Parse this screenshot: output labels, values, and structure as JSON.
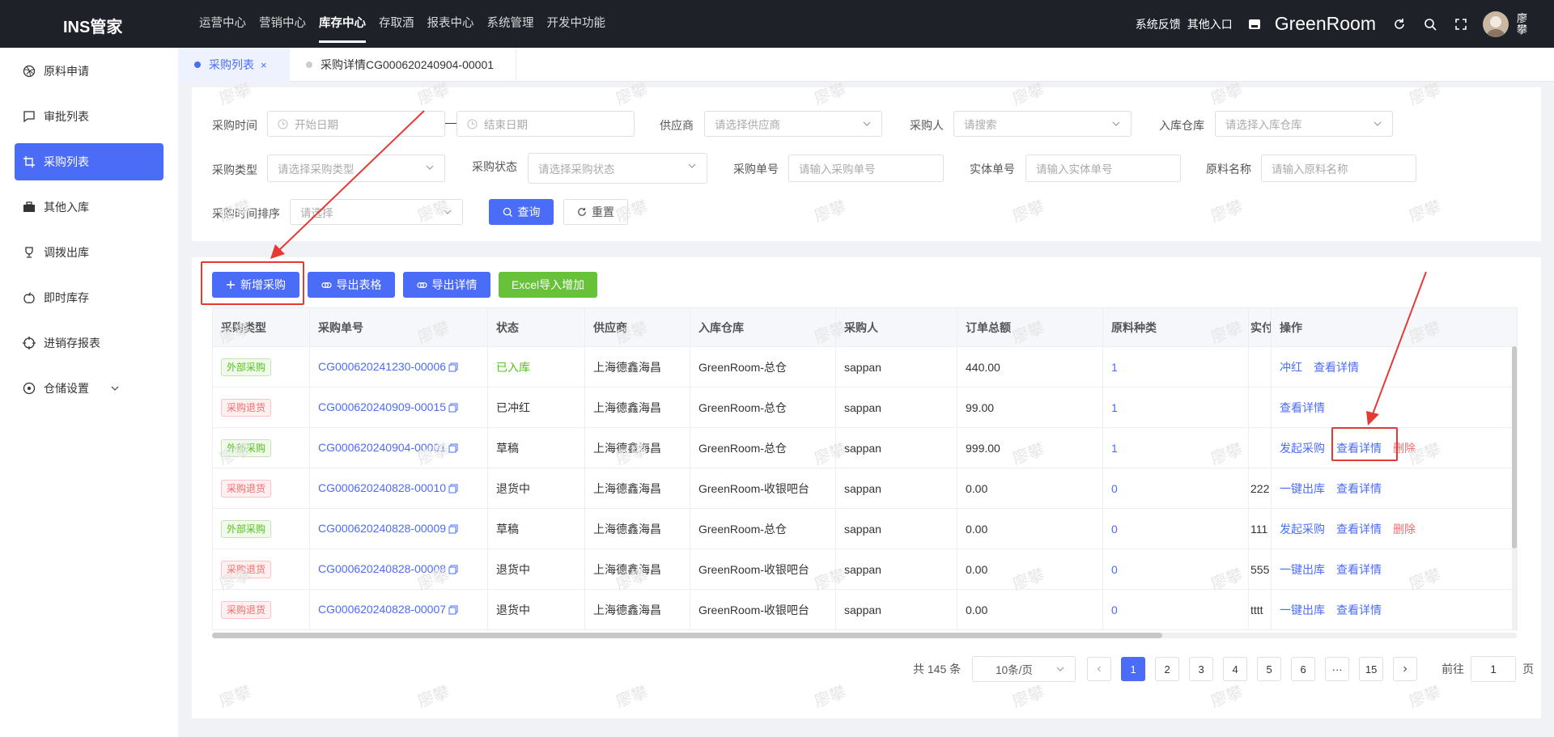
{
  "app": {
    "title": "INS管家"
  },
  "topnav": {
    "items": [
      {
        "label": "运营中心"
      },
      {
        "label": "营销中心"
      },
      {
        "label": "库存中心",
        "active": true
      },
      {
        "label": "存取酒"
      },
      {
        "label": "报表中心"
      },
      {
        "label": "系统管理"
      },
      {
        "label": "开发中功能"
      }
    ]
  },
  "topright": {
    "feedback": "系统反馈",
    "other": "其他入口",
    "store": "GreenRoom",
    "user": "廖攀"
  },
  "sidebar": {
    "items": [
      {
        "label": "原料申请",
        "icon": "dribbble-icon"
      },
      {
        "label": "审批列表",
        "icon": "message-icon"
      },
      {
        "label": "采购列表",
        "icon": "crop-icon",
        "active": true
      },
      {
        "label": "其他入库",
        "icon": "briefcase-icon"
      },
      {
        "label": "调拨出库",
        "icon": "trophy-icon"
      },
      {
        "label": "即时库存",
        "icon": "apple-icon"
      },
      {
        "label": "进销存报表",
        "icon": "aim-icon"
      },
      {
        "label": "仓储设置",
        "icon": "compass-icon"
      }
    ]
  },
  "tabs": [
    {
      "label": "采购列表",
      "active": true
    },
    {
      "label": "采购详情CG000620240904-00001"
    }
  ],
  "filters": {
    "purchase_time": {
      "label": "采购时间",
      "start": "开始日期",
      "end": "结束日期",
      "sep": "—"
    },
    "supplier": {
      "label": "供应商",
      "placeholder": "请选择供应商"
    },
    "buyer": {
      "label": "采购人",
      "placeholder": "请搜索"
    },
    "warehouse": {
      "label": "入库仓库",
      "placeholder": "请选择入库仓库"
    },
    "type": {
      "label": "采购类型",
      "placeholder": "请选择采购类型"
    },
    "status": {
      "label": "采购状态",
      "placeholder": "请选择采购状态"
    },
    "order_no": {
      "label": "采购单号",
      "placeholder": "请输入采购单号"
    },
    "entity_no": {
      "label": "实体单号",
      "placeholder": "请输入实体单号"
    },
    "material": {
      "label": "原料名称",
      "placeholder": "请输入原料名称"
    },
    "sort": {
      "label": "采购时间排序",
      "placeholder": "请选择"
    },
    "query_btn": "查询",
    "reset_btn": "重置"
  },
  "toolbar": {
    "add": "新增采购",
    "export_table": "导出表格",
    "export_detail": "导出详情",
    "excel_import": "Excel导入增加"
  },
  "table": {
    "columns": [
      "采购类型",
      "采购单号",
      "状态",
      "供应商",
      "入库仓库",
      "采购人",
      "订单总额",
      "原料种类",
      "实付",
      "操作"
    ],
    "rows": [
      {
        "type": "外部采购",
        "kind": "ext",
        "no": "CG000620241230-00006",
        "status": "已入库",
        "supplier": "上海德鑫海昌",
        "warehouse": "GreenRoom-总仓",
        "buyer": "sappan",
        "total": "440.00",
        "count": "1",
        "paid": "",
        "ops": [
          "冲红",
          "查看详情"
        ]
      },
      {
        "type": "采购退货",
        "kind": "ret",
        "no": "CG000620240909-00015",
        "status": "已冲红",
        "supplier": "上海德鑫海昌",
        "warehouse": "GreenRoom-总仓",
        "buyer": "sappan",
        "total": "99.00",
        "count": "1",
        "paid": "",
        "ops": [
          "查看详情"
        ]
      },
      {
        "type": "外部采购",
        "kind": "ext",
        "no": "CG000620240904-00001",
        "status": "草稿",
        "supplier": "上海德鑫海昌",
        "warehouse": "GreenRoom-总仓",
        "buyer": "sappan",
        "total": "999.00",
        "count": "1",
        "paid": "",
        "ops": [
          "发起采购",
          "查看详情",
          "删除"
        ]
      },
      {
        "type": "采购退货",
        "kind": "ret",
        "no": "CG000620240828-00010",
        "status": "退货中",
        "supplier": "上海德鑫海昌",
        "warehouse": "GreenRoom-收银吧台",
        "buyer": "sappan",
        "total": "0.00",
        "count": "0",
        "paid": "222",
        "ops": [
          "一键出库",
          "查看详情"
        ]
      },
      {
        "type": "外部采购",
        "kind": "ext",
        "no": "CG000620240828-00009",
        "status": "草稿",
        "supplier": "上海德鑫海昌",
        "warehouse": "GreenRoom-总仓",
        "buyer": "sappan",
        "total": "0.00",
        "count": "0",
        "paid": "111",
        "ops": [
          "发起采购",
          "查看详情",
          "删除"
        ]
      },
      {
        "type": "采购退货",
        "kind": "ret",
        "no": "CG000620240828-00008",
        "status": "退货中",
        "supplier": "上海德鑫海昌",
        "warehouse": "GreenRoom-收银吧台",
        "buyer": "sappan",
        "total": "0.00",
        "count": "0",
        "paid": "555",
        "ops": [
          "一键出库",
          "查看详情"
        ]
      },
      {
        "type": "采购退货",
        "kind": "ret",
        "no": "CG000620240828-00007",
        "status": "退货中",
        "supplier": "上海德鑫海昌",
        "warehouse": "GreenRoom-收银吧台",
        "buyer": "sappan",
        "total": "0.00",
        "count": "0",
        "paid": "tttt",
        "ops": [
          "一键出库",
          "查看详情"
        ]
      }
    ]
  },
  "pager": {
    "total": "共 145 条",
    "size": "10条/页",
    "pages": [
      "1",
      "2",
      "3",
      "4",
      "5",
      "6",
      "···",
      "15"
    ],
    "current": "1",
    "goto_label": "前往",
    "goto_value": "1",
    "goto_suffix": "页"
  },
  "watermark": "廖攀",
  "colors": {
    "primary": "#4b6cf7",
    "success": "#52c41a",
    "danger": "#f56c6c",
    "topbar": "#1f2129"
  }
}
